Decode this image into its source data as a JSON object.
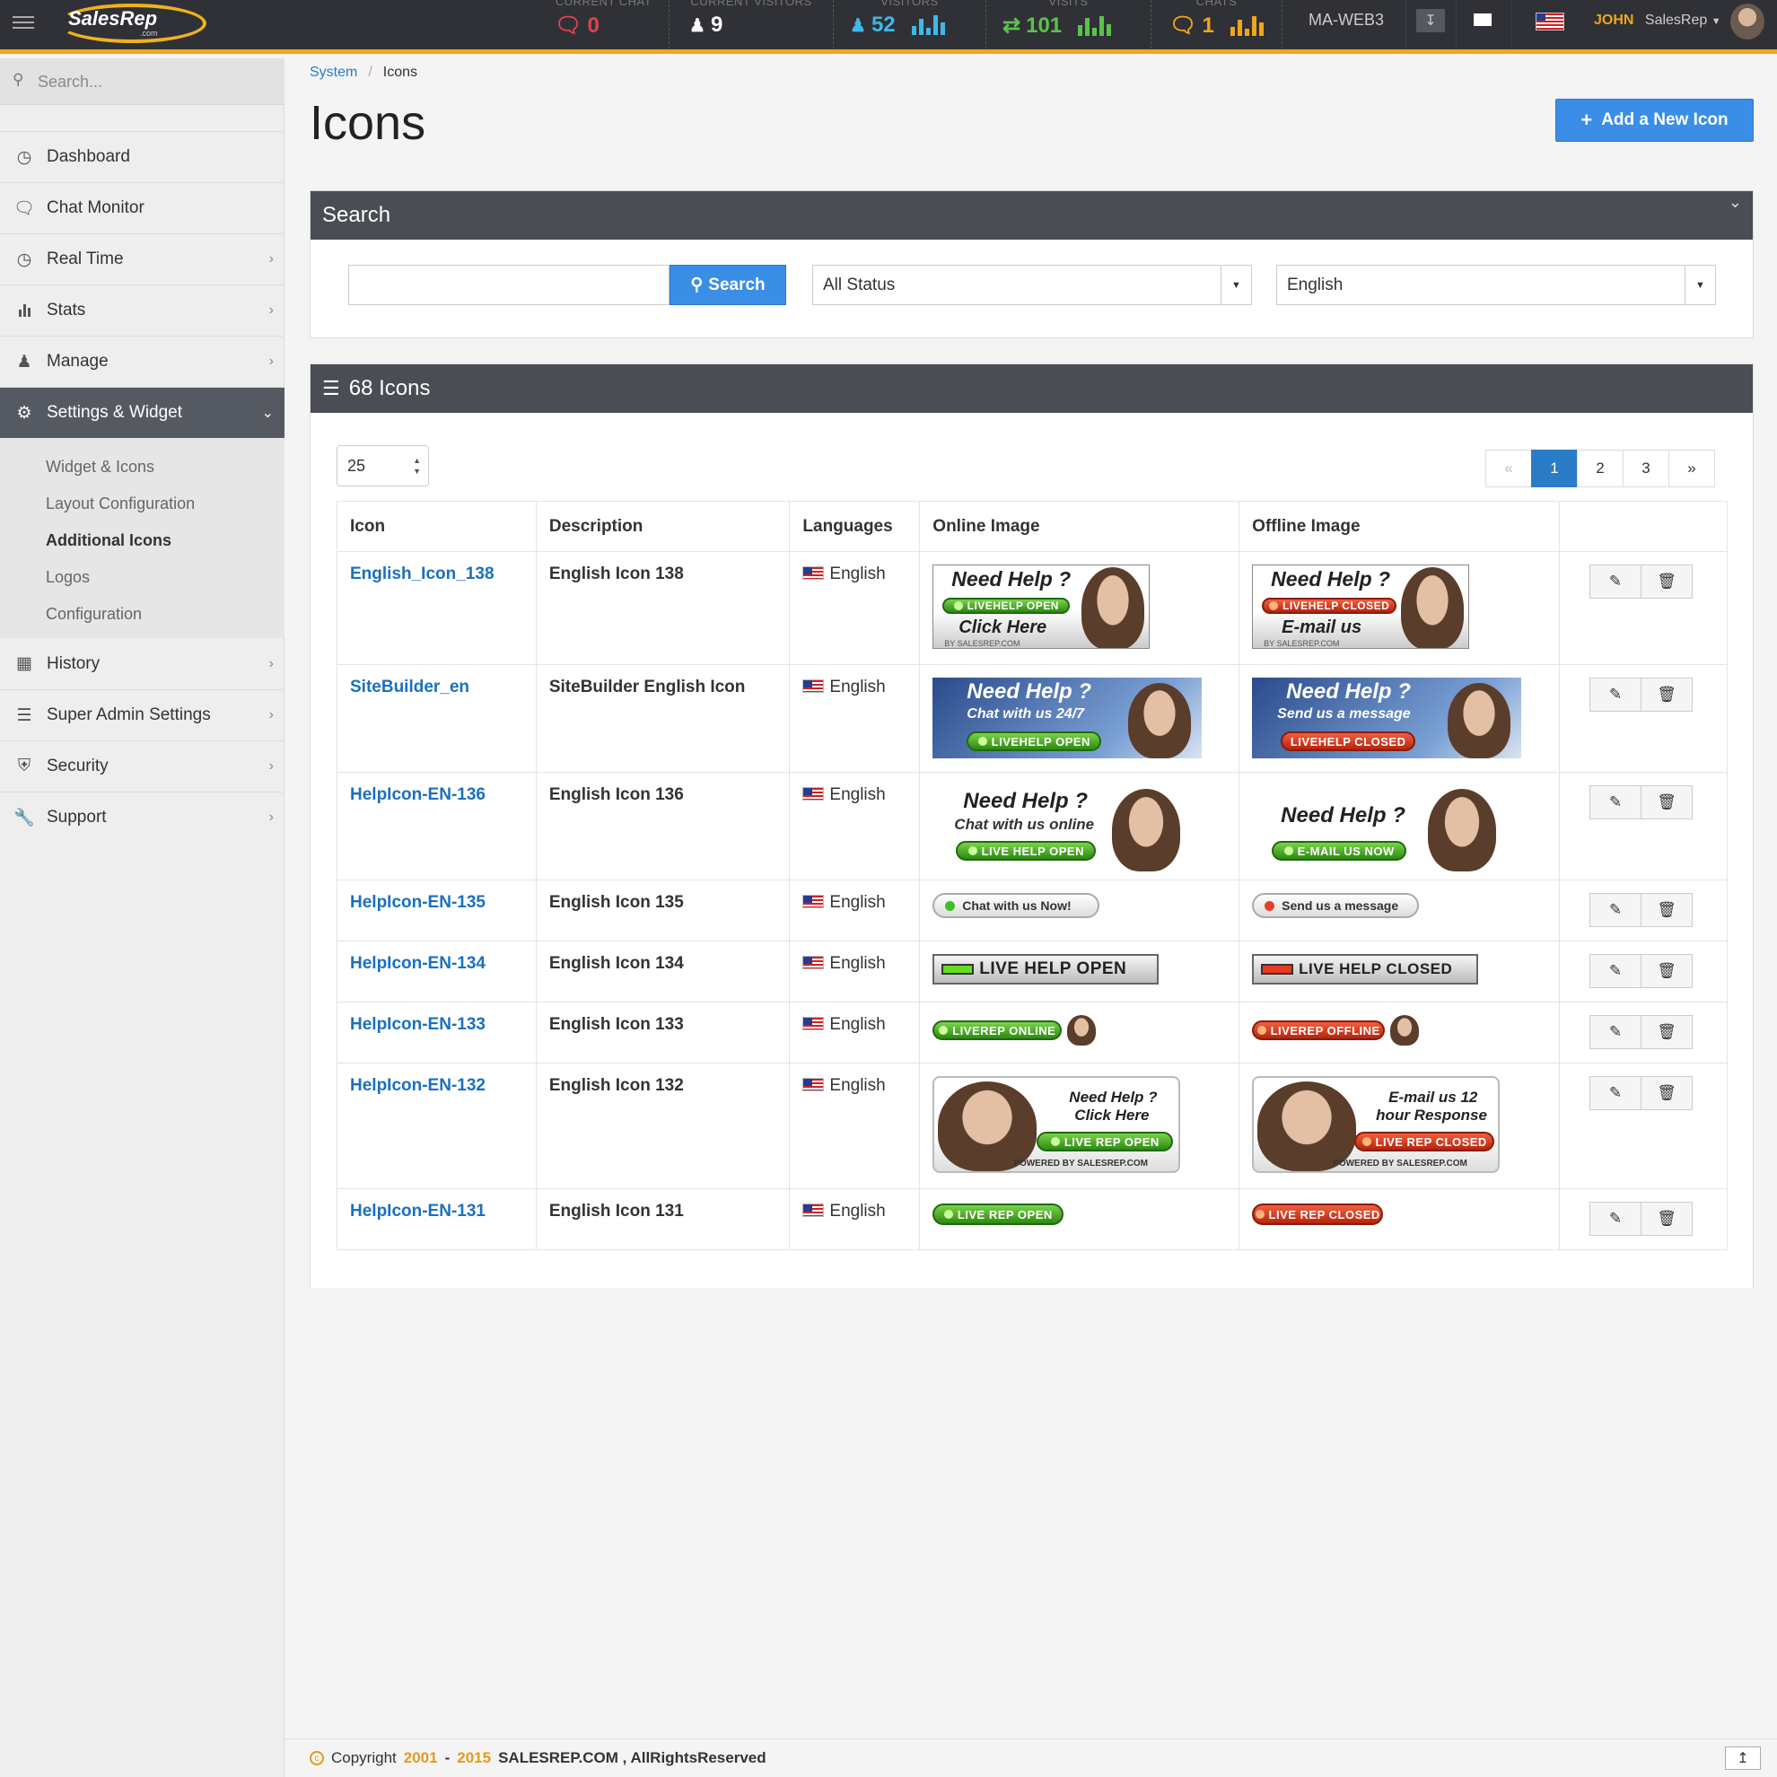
{
  "topbar": {
    "logo_text": "SalesRep",
    "logo_sub": ".com",
    "stats": [
      {
        "label": "CURRENT CHAT",
        "value": "0",
        "color": "#e0414f"
      },
      {
        "label": "CURRENT VISITORS",
        "value": "9",
        "color": "#ffffff"
      },
      {
        "label": "VISITORS",
        "value": "52",
        "color": "#3fb8e8"
      },
      {
        "label": "VISITS",
        "value": "101",
        "color": "#5bc24b"
      },
      {
        "label": "CHATS",
        "value": "1",
        "color": "#f0a51c"
      }
    ],
    "server": "MA-WEB3",
    "user_first": "JOHN",
    "user_last": "SalesRep"
  },
  "sidebar": {
    "search_placeholder": "Search...",
    "items": [
      {
        "label": "Dashboard",
        "icon": "dashboard-icon"
      },
      {
        "label": "Chat Monitor",
        "icon": "chat-icon"
      },
      {
        "label": "Real Time",
        "icon": "clock-icon"
      },
      {
        "label": "Stats",
        "icon": "bar-chart-icon"
      },
      {
        "label": "Manage",
        "icon": "user-icon"
      },
      {
        "label": "Settings & Widget",
        "icon": "gear-icon"
      },
      {
        "label": "History",
        "icon": "calendar-icon"
      },
      {
        "label": "Super Admin Settings",
        "icon": "server-icon"
      },
      {
        "label": "Security",
        "icon": "shield-icon"
      },
      {
        "label": "Support",
        "icon": "wrench-icon"
      }
    ],
    "subitems": [
      "Widget & Icons",
      "Layout Configuration",
      "Additional Icons",
      "Logos",
      "Configuration"
    ]
  },
  "breadcrumb": {
    "parent": "System",
    "current": "Icons"
  },
  "page_title": "Icons",
  "add_button": "Add a New Icon",
  "search_panel": {
    "title": "Search",
    "button": "Search",
    "status_value": "All Status",
    "language_value": "English"
  },
  "list_panel": {
    "title": "68 Icons",
    "per_page": "25",
    "pages": [
      "1",
      "2",
      "3"
    ],
    "columns": [
      "Icon",
      "Description",
      "Languages",
      "Online Image",
      "Offline Image"
    ]
  },
  "rows": [
    {
      "name": "English_Icon_138",
      "desc": "English Icon 138",
      "lang": "English"
    },
    {
      "name": "SiteBuilder_en",
      "desc": "SiteBuilder English Icon",
      "lang": "English"
    },
    {
      "name": "HelpIcon-EN-136",
      "desc": "English Icon 136",
      "lang": "English"
    },
    {
      "name": "HelpIcon-EN-135",
      "desc": "English Icon 135",
      "lang": "English"
    },
    {
      "name": "HelpIcon-EN-134",
      "desc": "English Icon 134",
      "lang": "English"
    },
    {
      "name": "HelpIcon-EN-133",
      "desc": "English Icon 133",
      "lang": "English"
    },
    {
      "name": "HelpIcon-EN-132",
      "desc": "English Icon 132",
      "lang": "English"
    },
    {
      "name": "HelpIcon-EN-131",
      "desc": "English Icon 131",
      "lang": "English"
    }
  ],
  "banners": {
    "b138_on": {
      "h1": "Need Help ?",
      "pill": "LIVEHELP OPEN",
      "h2": "Click Here",
      "foot": "BY SALESREP.COM"
    },
    "b138_off": {
      "h1": "Need Help ?",
      "pill": "LIVEHELP CLOSED",
      "h2": "E-mail us",
      "foot": "BY SALESREP.COM"
    },
    "sb_on": {
      "h1": "Need Help ?",
      "h2": "Chat with us 24/7",
      "pill": "LIVEHELP OPEN"
    },
    "sb_off": {
      "h1": "Need Help ?",
      "h2": "Send us a message",
      "pill": "LIVEHELP CLOSED"
    },
    "b136_on": {
      "h1": "Need Help ?",
      "h2": "Chat with us online",
      "pill": "LIVE HELP OPEN"
    },
    "b136_off": {
      "h1": "Need Help ?",
      "pill": "E-MAIL US NOW"
    },
    "b135_on": "Chat with us Now!",
    "b135_off": "Send us a message",
    "b134_on": "LIVE HELP OPEN",
    "b134_off": "LIVE HELP CLOSED",
    "b133_on": "LIVEREP ONLINE",
    "b133_off": "LIVEREP OFFLINE",
    "b132_on": {
      "h1": "Need Help ?",
      "h2": "Click Here",
      "pill": "LIVE REP OPEN",
      "foot": "POWERED BY SALESREP.COM"
    },
    "b132_off": {
      "h1": "E-mail us 12",
      "h2": "hour Response",
      "pill": "LIVE REP CLOSED",
      "foot": "POWERED BY SALESREP.COM"
    },
    "b131_on": "LIVE REP OPEN",
    "b131_off": "LIVE REP CLOSED"
  },
  "footer": {
    "pre": "Copyright",
    "y1": "2001",
    "dash": "-",
    "y2": "2015",
    "post": "SALESREP.COM , AllRightsReserved"
  },
  "colors": {
    "accent": "#3a8ee6",
    "topbar": "#2f3136",
    "highlight": "#f0a51c",
    "link": "#1a70c0"
  }
}
